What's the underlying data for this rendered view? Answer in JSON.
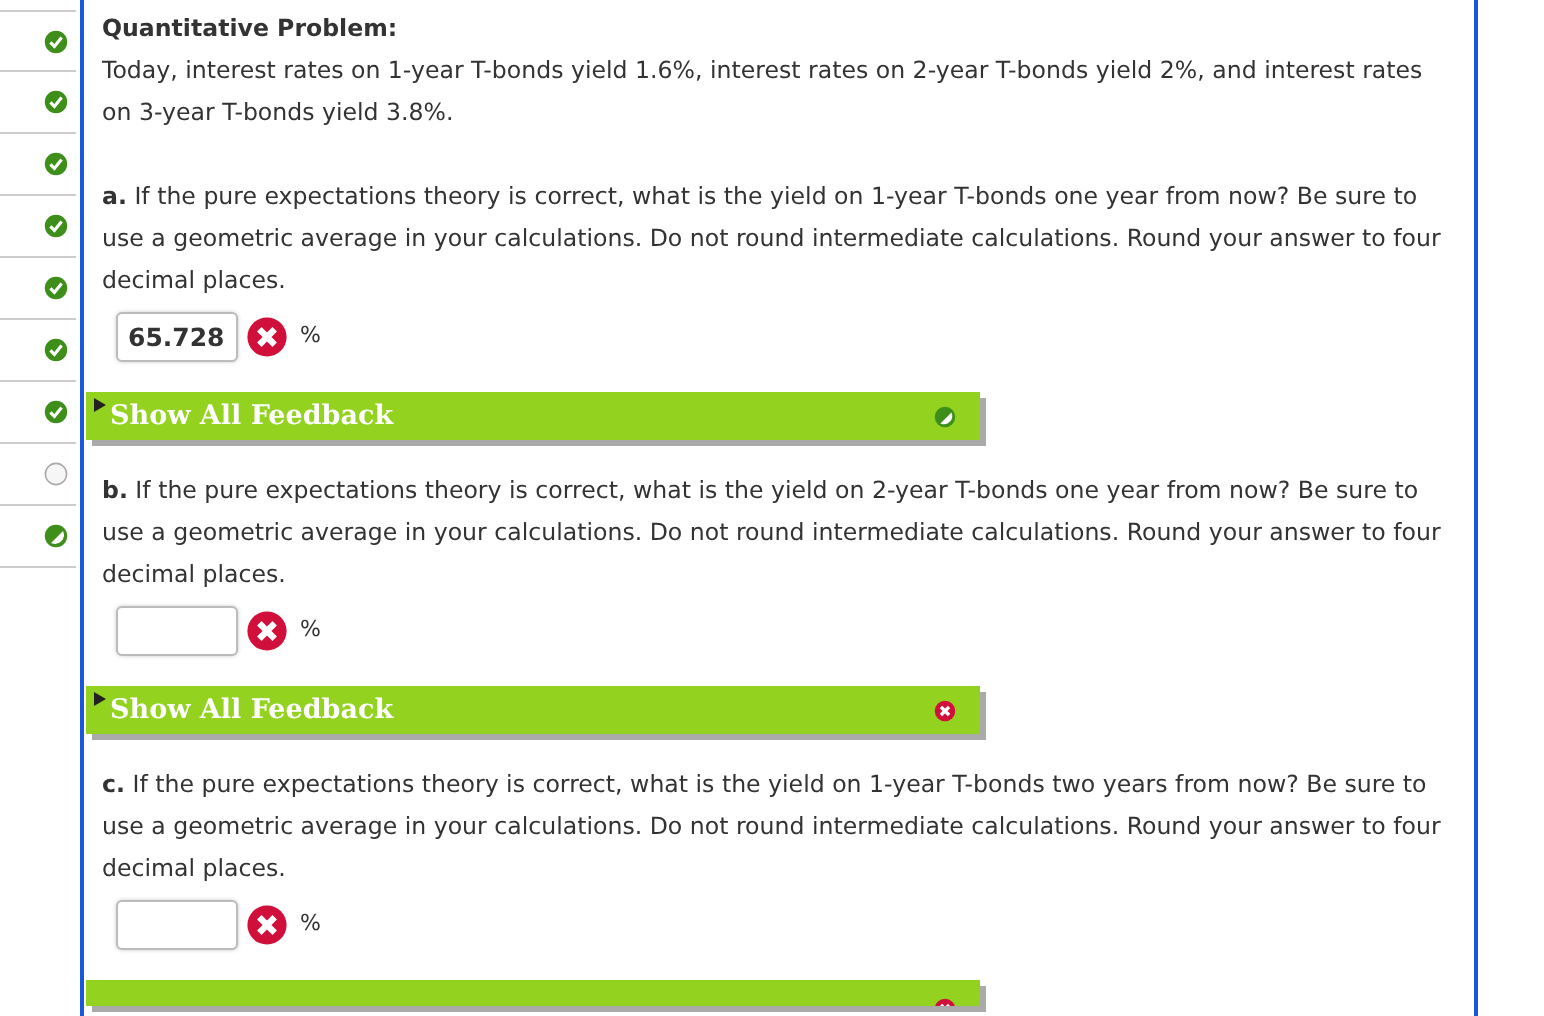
{
  "sidebar": {
    "items": [
      {
        "kind": "correct"
      },
      {
        "kind": "correct"
      },
      {
        "kind": "correct"
      },
      {
        "kind": "correct"
      },
      {
        "kind": "correct"
      },
      {
        "kind": "correct"
      },
      {
        "kind": "correct"
      },
      {
        "kind": "empty"
      },
      {
        "kind": "partial"
      }
    ]
  },
  "problem": {
    "title": "Quantitative Problem:",
    "text": "Today, interest rates on 1-year T-bonds yield 1.6%, interest rates on 2-year T-bonds yield 2%, and interest rates on 3-year T-bonds yield 3.8%."
  },
  "parts": [
    {
      "question": "**a.** If the pure expectations theory is correct, what is the yield on 1-year T-bonds one year from now? Be sure to use a geometric average in your calculations. Do not round intermediate calculations. Round your answer to four decimal places.",
      "answer": "65.728",
      "result": {
        "kind": "wrong"
      },
      "unit": "%",
      "feedback": {
        "label": "Show All Feedback",
        "kind": "partial"
      }
    },
    {
      "question": "**b.** If the pure expectations theory is correct, what is the yield on 2-year T-bonds one year from now? Be sure to use a geometric average in your calculations. Do not round intermediate calculations. Round your answer to four decimal places.",
      "result": {
        "kind": "wrong"
      },
      "unit": "%",
      "feedback": {
        "label": "Show All Feedback",
        "kind": "wrong"
      }
    },
    {
      "question": "**c.** If the pure expectations theory is correct, what is the yield on 1-year T-bonds two years from now? Be sure to use a geometric average in your calculations. Do not round intermediate calculations. Round your answer to four decimal places.",
      "result": {
        "kind": "wrong"
      },
      "unit": "%",
      "feedback": {
        "kind": "wrong"
      }
    }
  ]
}
